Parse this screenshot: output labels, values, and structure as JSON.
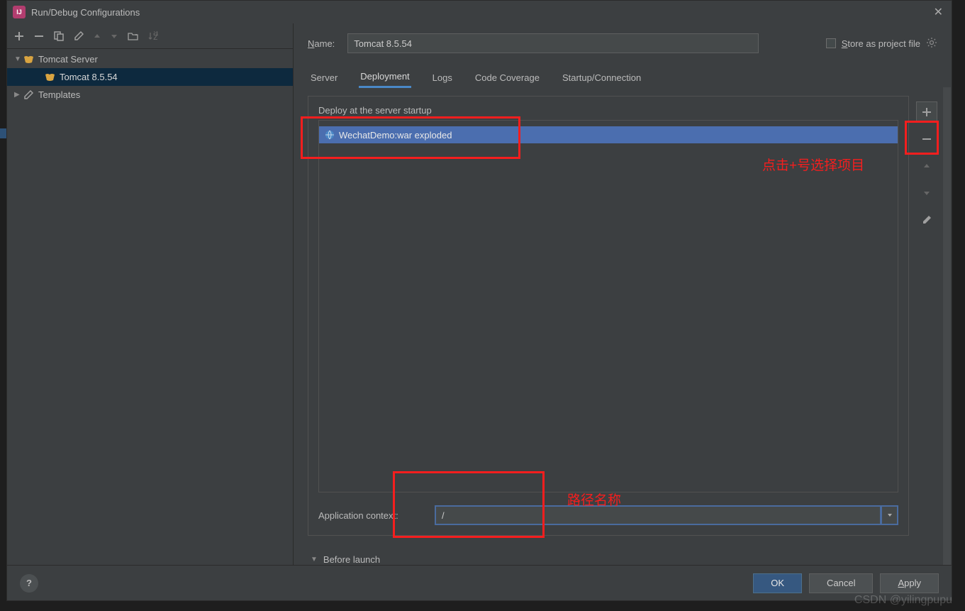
{
  "window": {
    "title": "Run/Debug Configurations"
  },
  "sidebar": {
    "items": [
      {
        "label": "Tomcat Server",
        "expanded": true
      },
      {
        "label": "Tomcat 8.5.54",
        "selected": true
      },
      {
        "label": "Templates",
        "expanded": false
      }
    ]
  },
  "header": {
    "name_label": "Name:",
    "name_value": "Tomcat 8.5.54",
    "store_label": "Store as project file"
  },
  "tabs": {
    "items": [
      "Server",
      "Deployment",
      "Logs",
      "Code Coverage",
      "Startup/Connection"
    ],
    "active": "Deployment"
  },
  "deployment": {
    "section_label": "Deploy at the server startup",
    "artifacts": [
      "WechatDemo:war exploded"
    ],
    "appctx_label": "Application context:",
    "appctx_value": "/"
  },
  "before_launch": {
    "label": "Before launch"
  },
  "annotations": {
    "plus_hint": "点击+号选择项目",
    "path_hint": "路径名称"
  },
  "footer": {
    "ok": "OK",
    "cancel": "Cancel",
    "apply": "Apply"
  },
  "watermark": "CSDN @yilingpupu"
}
